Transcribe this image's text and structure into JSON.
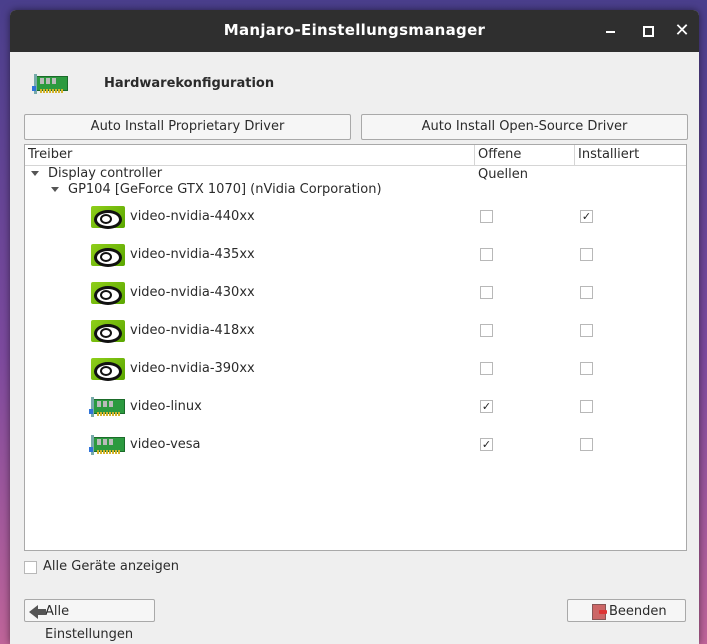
{
  "window": {
    "title": "Manjaro-Einstellungsmanager"
  },
  "header": {
    "title": "Hardwarekonfiguration"
  },
  "actions": {
    "auto_proprietary": "Auto Install Proprietary Driver",
    "auto_open_source": "Auto Install Open-Source Driver"
  },
  "columns": {
    "driver": "Treiber",
    "open_source": "Offene Quellen",
    "installed": "Installiert"
  },
  "tree": {
    "category": "Display controller",
    "device": "GP104 [GeForce GTX 1070] (nVidia Corporation)",
    "drivers": [
      {
        "name": "video-nvidia-440xx",
        "icon": "nvidia-icon",
        "open_source": false,
        "installed": true
      },
      {
        "name": "video-nvidia-435xx",
        "icon": "nvidia-icon",
        "open_source": false,
        "installed": false
      },
      {
        "name": "video-nvidia-430xx",
        "icon": "nvidia-icon",
        "open_source": false,
        "installed": false
      },
      {
        "name": "video-nvidia-418xx",
        "icon": "nvidia-icon",
        "open_source": false,
        "installed": false
      },
      {
        "name": "video-nvidia-390xx",
        "icon": "nvidia-icon",
        "open_source": false,
        "installed": false
      },
      {
        "name": "video-linux",
        "icon": "pci-card-icon",
        "open_source": true,
        "installed": false
      },
      {
        "name": "video-vesa",
        "icon": "pci-card-icon",
        "open_source": true,
        "installed": false
      }
    ]
  },
  "options": {
    "show_all_devices": "Alle Geräte anzeigen",
    "show_all_checked": false
  },
  "footer": {
    "back_label": "Alle Einstellungen",
    "quit_label": "Beenden"
  },
  "glyphs": {
    "check": "✓",
    "close": "✕"
  },
  "colors": {
    "titlebar": "#2f2f2f",
    "window_bg": "#efefef",
    "nvidia_green": "#76b900"
  }
}
